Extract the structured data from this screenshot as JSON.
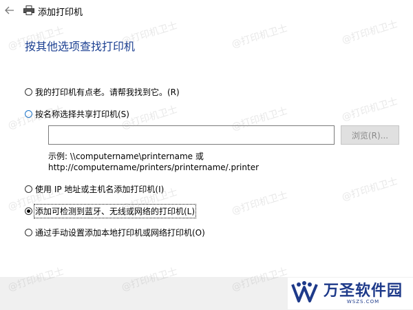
{
  "window": {
    "title": "添加打印机",
    "back_icon": "arrow-left-icon",
    "printer_icon": "printer-icon"
  },
  "heading": "按其他选项查找打印机",
  "options": [
    {
      "label": "我的打印机有点老。请帮我找到它。(R)",
      "checked": false
    },
    {
      "label": "按名称选择共享打印机(S)",
      "checked": false
    },
    {
      "label": "使用 IP 地址或主机名添加打印机(I)",
      "checked": false
    },
    {
      "label": "添加可检测到蓝牙、无线或网络的打印机(L)",
      "checked": true
    },
    {
      "label": "通过手动设置添加本地打印机或网络打印机(O)",
      "checked": false
    }
  ],
  "share": {
    "input_value": "",
    "browse_label": "浏览(R)...",
    "example_line1": "示例: \\\\computername\\printername 或",
    "example_line2": "http://computername/printers/printername/.printer"
  },
  "watermark": "@打印机卫士",
  "logo": {
    "name": "万圣软件园",
    "domain": "WSZS.COM"
  },
  "colors": {
    "heading": "#1b3f91",
    "radio_focus": "#1a73c9",
    "footer": "#f0f0f0",
    "logo": "#1e3a8a"
  }
}
